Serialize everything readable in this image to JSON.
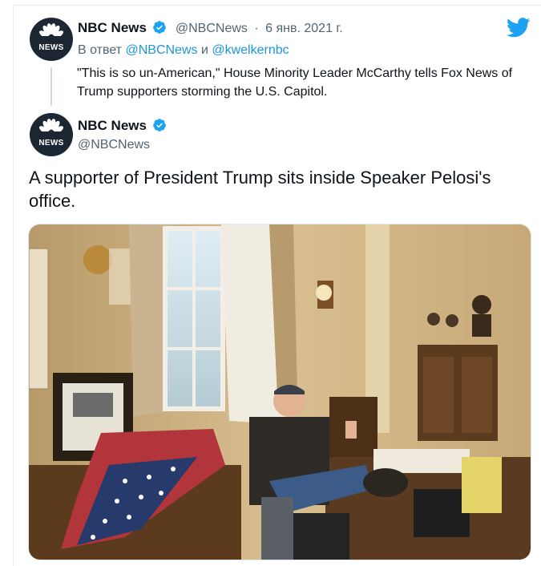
{
  "reply_tweet": {
    "display_name": "NBC News",
    "handle": "@NBCNews",
    "separator": "·",
    "date": "6 янв. 2021 г.",
    "reply_prefix": "В ответ",
    "reply_conjunction": "и",
    "reply_to_1": "@NBCNews",
    "reply_to_2": "@kwelkernbc",
    "text": "\"This is so un-American,\" House Minority Leader McCarthy tells Fox News of Trump supporters storming the U.S. Capitol."
  },
  "main_tweet": {
    "display_name": "NBC News",
    "handle": "@NBCNews",
    "text": "A supporter of President Trump sits inside Speaker Pelosi's office."
  },
  "avatar_label": "NEWS",
  "colors": {
    "twitter_blue": "#1da1f2",
    "link": "#1b95e0",
    "muted": "#536471",
    "avatar_bg": "#1d2733"
  },
  "icons": {
    "brand": "twitter-bird-icon",
    "verified": "verified-badge-icon",
    "avatar": "nbc-peacock-logo"
  }
}
